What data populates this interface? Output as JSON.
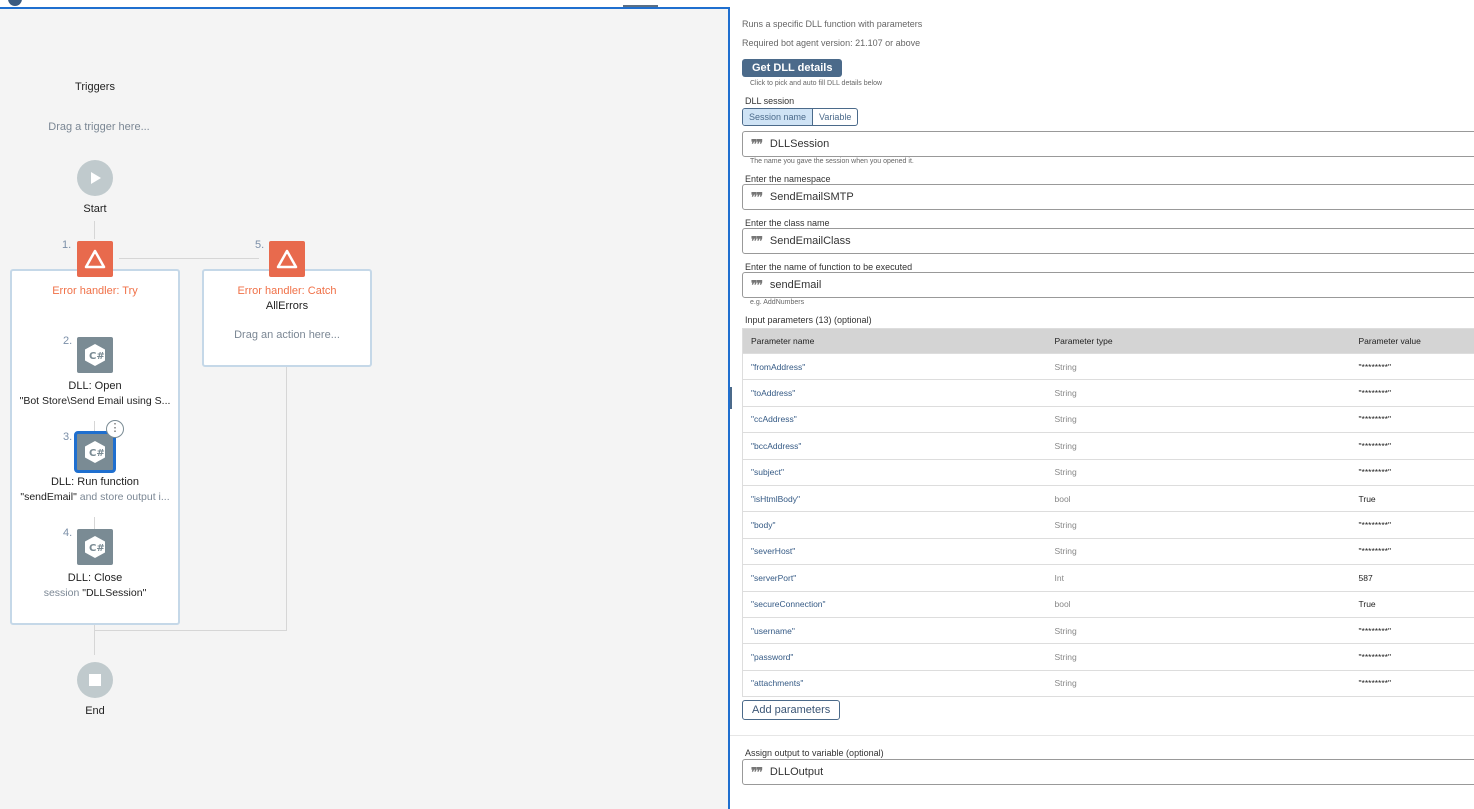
{
  "canvas": {
    "triggers_label": "Triggers",
    "trigger_placeholder": "Drag a trigger here...",
    "start_label": "Start",
    "end_label": "End",
    "steps": [
      {
        "number": "1.",
        "title": "Error handler: Try"
      },
      {
        "number": "2.",
        "title": "DLL: Open",
        "detail": "\"Bot Store\\Send Email using S..."
      },
      {
        "number": "3.",
        "title": "DLL: Run function",
        "detail_highlight": "\"sendEmail\"",
        "detail_rest": " and store output i..."
      },
      {
        "number": "4.",
        "title": "DLL: Close",
        "detail_prefix": "session ",
        "detail_highlight": "\"DLLSession\""
      },
      {
        "number": "5.",
        "title": "Error handler: Catch",
        "subtitle": "AllErrors",
        "placeholder": "Drag an action here..."
      }
    ]
  },
  "panel": {
    "description": "Runs a specific DLL function with parameters",
    "version": "Required bot agent version: 21.107 or above",
    "get_dll_button": "Get DLL details",
    "get_dll_hint": "Click to pick and auto fill DLL details below",
    "session_label": "DLL session",
    "session_tabs": [
      "Session name",
      "Variable"
    ],
    "session_value": "DLLSession",
    "session_hint": "The name you gave the session when you opened it.",
    "namespace_label": "Enter the namespace",
    "namespace_value": "SendEmailSMTP",
    "class_label": "Enter the class name",
    "class_value": "SendEmailClass",
    "function_label": "Enter the name of function to be executed",
    "function_value": "sendEmail",
    "function_hint": "e.g. AddNumbers",
    "params_label": "Input parameters (13) (optional)",
    "columns": [
      "Parameter name",
      "Parameter type",
      "Parameter value"
    ],
    "params": [
      [
        "\"fromAddress\"",
        "String",
        "\"********\""
      ],
      [
        "\"toAddress\"",
        "String",
        "\"********\""
      ],
      [
        "\"ccAddress\"",
        "String",
        "\"********\""
      ],
      [
        "\"bccAddress\"",
        "String",
        "\"********\""
      ],
      [
        "\"subject\"",
        "String",
        "\"********\""
      ],
      [
        "\"isHtmlBody\"",
        "bool",
        "True"
      ],
      [
        "\"body\"",
        "String",
        "\"********\""
      ],
      [
        "\"severHost\"",
        "String",
        "\"********\""
      ],
      [
        "\"serverPort\"",
        "Int",
        "587"
      ],
      [
        "\"secureConnection\"",
        "bool",
        "True"
      ],
      [
        "\"username\"",
        "String",
        "\"********\""
      ],
      [
        "\"password\"",
        "String",
        "\"********\""
      ],
      [
        "\"attachments\"",
        "String",
        "\"********\""
      ]
    ],
    "add_params_button": "Add parameters",
    "output_label": "Assign output to variable (optional)",
    "output_value": "DLLOutput"
  }
}
